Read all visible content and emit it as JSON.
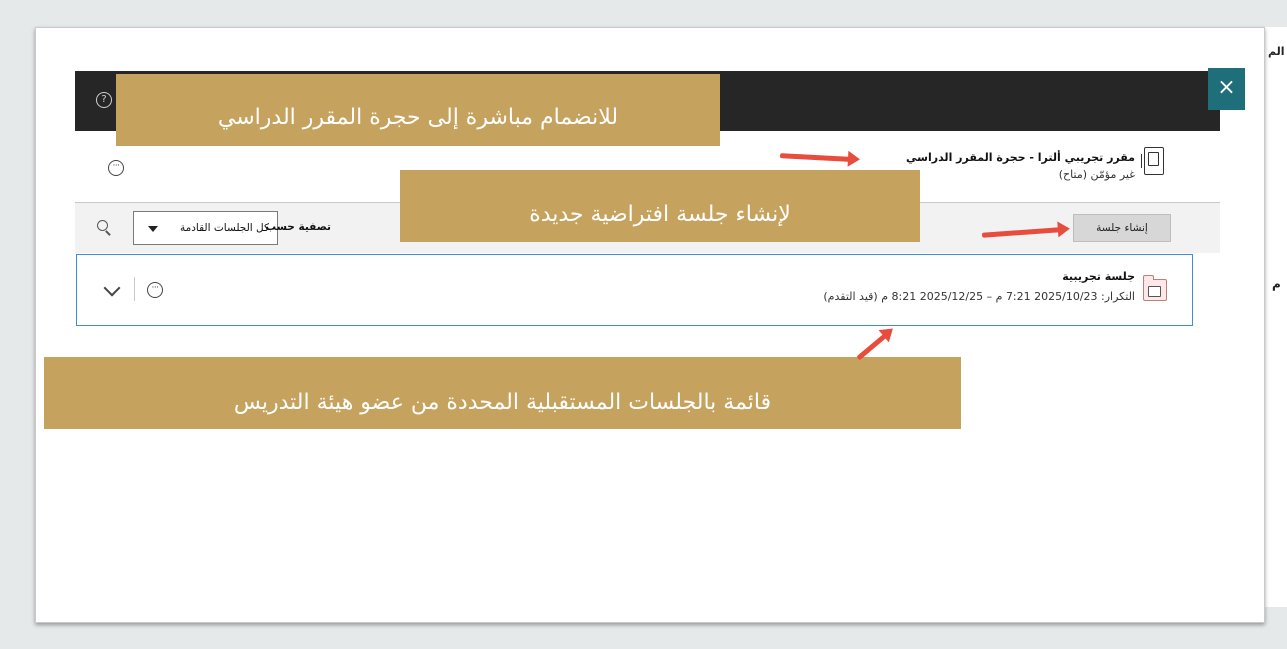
{
  "header": {
    "help_icon": "help-circle-icon",
    "close_label": "×"
  },
  "room": {
    "title": "مقرر تجريبي ألترا - حجرة المقرر الدراسي",
    "status": "غير مؤمّن (متاح)"
  },
  "toolbar": {
    "create_session_label": "إنشاء جلسة",
    "filter_label": "تصفية حسب",
    "filter_value": "كل الجلسات القادمة"
  },
  "session": {
    "title": "جلسة تجريبية",
    "detail": "التكرار: 2025/10/23 7:21 م – 2025/12/25 8:21 م (قيد التقدم)"
  },
  "callouts": {
    "join_room": "للانضمام مباشرة إلى حجرة المقرر الدراسي",
    "create_session": "لإنشاء جلسة افتراضية جديدة",
    "upcoming_list": "قائمة بالجلسات المستقبلية المحددة من عضو هيئة التدريس"
  },
  "background_edge": {
    "text_top": "الم",
    "text_mid": "م"
  },
  "colors": {
    "callout": "#c5a25d",
    "arrow": "#e74c3c",
    "header": "#262626",
    "close": "#1e6f7a",
    "selected_border": "#3b8fd5"
  }
}
